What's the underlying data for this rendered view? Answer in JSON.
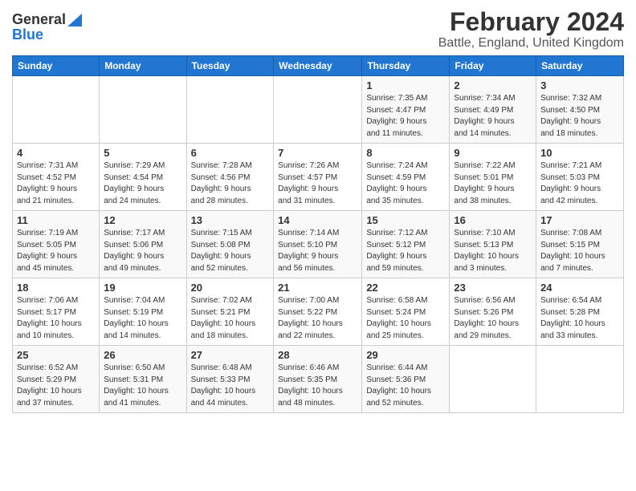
{
  "logo": {
    "general": "General",
    "blue": "Blue"
  },
  "title": "February 2024",
  "subtitle": "Battle, England, United Kingdom",
  "weekdays": [
    "Sunday",
    "Monday",
    "Tuesday",
    "Wednesday",
    "Thursday",
    "Friday",
    "Saturday"
  ],
  "weeks": [
    [
      {
        "day": "",
        "detail": ""
      },
      {
        "day": "",
        "detail": ""
      },
      {
        "day": "",
        "detail": ""
      },
      {
        "day": "",
        "detail": ""
      },
      {
        "day": "1",
        "detail": "Sunrise: 7:35 AM\nSunset: 4:47 PM\nDaylight: 9 hours\nand 11 minutes."
      },
      {
        "day": "2",
        "detail": "Sunrise: 7:34 AM\nSunset: 4:49 PM\nDaylight: 9 hours\nand 14 minutes."
      },
      {
        "day": "3",
        "detail": "Sunrise: 7:32 AM\nSunset: 4:50 PM\nDaylight: 9 hours\nand 18 minutes."
      }
    ],
    [
      {
        "day": "4",
        "detail": "Sunrise: 7:31 AM\nSunset: 4:52 PM\nDaylight: 9 hours\nand 21 minutes."
      },
      {
        "day": "5",
        "detail": "Sunrise: 7:29 AM\nSunset: 4:54 PM\nDaylight: 9 hours\nand 24 minutes."
      },
      {
        "day": "6",
        "detail": "Sunrise: 7:28 AM\nSunset: 4:56 PM\nDaylight: 9 hours\nand 28 minutes."
      },
      {
        "day": "7",
        "detail": "Sunrise: 7:26 AM\nSunset: 4:57 PM\nDaylight: 9 hours\nand 31 minutes."
      },
      {
        "day": "8",
        "detail": "Sunrise: 7:24 AM\nSunset: 4:59 PM\nDaylight: 9 hours\nand 35 minutes."
      },
      {
        "day": "9",
        "detail": "Sunrise: 7:22 AM\nSunset: 5:01 PM\nDaylight: 9 hours\nand 38 minutes."
      },
      {
        "day": "10",
        "detail": "Sunrise: 7:21 AM\nSunset: 5:03 PM\nDaylight: 9 hours\nand 42 minutes."
      }
    ],
    [
      {
        "day": "11",
        "detail": "Sunrise: 7:19 AM\nSunset: 5:05 PM\nDaylight: 9 hours\nand 45 minutes."
      },
      {
        "day": "12",
        "detail": "Sunrise: 7:17 AM\nSunset: 5:06 PM\nDaylight: 9 hours\nand 49 minutes."
      },
      {
        "day": "13",
        "detail": "Sunrise: 7:15 AM\nSunset: 5:08 PM\nDaylight: 9 hours\nand 52 minutes."
      },
      {
        "day": "14",
        "detail": "Sunrise: 7:14 AM\nSunset: 5:10 PM\nDaylight: 9 hours\nand 56 minutes."
      },
      {
        "day": "15",
        "detail": "Sunrise: 7:12 AM\nSunset: 5:12 PM\nDaylight: 9 hours\nand 59 minutes."
      },
      {
        "day": "16",
        "detail": "Sunrise: 7:10 AM\nSunset: 5:13 PM\nDaylight: 10 hours\nand 3 minutes."
      },
      {
        "day": "17",
        "detail": "Sunrise: 7:08 AM\nSunset: 5:15 PM\nDaylight: 10 hours\nand 7 minutes."
      }
    ],
    [
      {
        "day": "18",
        "detail": "Sunrise: 7:06 AM\nSunset: 5:17 PM\nDaylight: 10 hours\nand 10 minutes."
      },
      {
        "day": "19",
        "detail": "Sunrise: 7:04 AM\nSunset: 5:19 PM\nDaylight: 10 hours\nand 14 minutes."
      },
      {
        "day": "20",
        "detail": "Sunrise: 7:02 AM\nSunset: 5:21 PM\nDaylight: 10 hours\nand 18 minutes."
      },
      {
        "day": "21",
        "detail": "Sunrise: 7:00 AM\nSunset: 5:22 PM\nDaylight: 10 hours\nand 22 minutes."
      },
      {
        "day": "22",
        "detail": "Sunrise: 6:58 AM\nSunset: 5:24 PM\nDaylight: 10 hours\nand 25 minutes."
      },
      {
        "day": "23",
        "detail": "Sunrise: 6:56 AM\nSunset: 5:26 PM\nDaylight: 10 hours\nand 29 minutes."
      },
      {
        "day": "24",
        "detail": "Sunrise: 6:54 AM\nSunset: 5:28 PM\nDaylight: 10 hours\nand 33 minutes."
      }
    ],
    [
      {
        "day": "25",
        "detail": "Sunrise: 6:52 AM\nSunset: 5:29 PM\nDaylight: 10 hours\nand 37 minutes."
      },
      {
        "day": "26",
        "detail": "Sunrise: 6:50 AM\nSunset: 5:31 PM\nDaylight: 10 hours\nand 41 minutes."
      },
      {
        "day": "27",
        "detail": "Sunrise: 6:48 AM\nSunset: 5:33 PM\nDaylight: 10 hours\nand 44 minutes."
      },
      {
        "day": "28",
        "detail": "Sunrise: 6:46 AM\nSunset: 5:35 PM\nDaylight: 10 hours\nand 48 minutes."
      },
      {
        "day": "29",
        "detail": "Sunrise: 6:44 AM\nSunset: 5:36 PM\nDaylight: 10 hours\nand 52 minutes."
      },
      {
        "day": "",
        "detail": ""
      },
      {
        "day": "",
        "detail": ""
      }
    ]
  ]
}
